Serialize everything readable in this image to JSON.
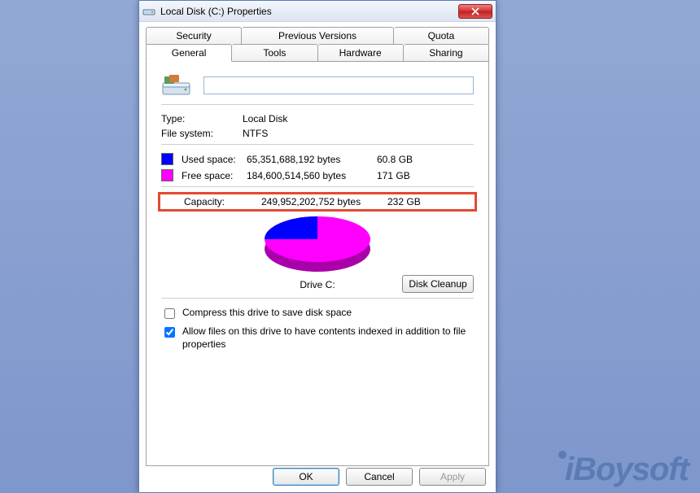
{
  "window": {
    "title": "Local Disk (C:) Properties"
  },
  "tabs_back": [
    {
      "label": "Security"
    },
    {
      "label": "Previous Versions"
    },
    {
      "label": "Quota"
    }
  ],
  "tabs_front": [
    {
      "label": "General"
    },
    {
      "label": "Tools"
    },
    {
      "label": "Hardware"
    },
    {
      "label": "Sharing"
    }
  ],
  "drive_name": "",
  "info": {
    "type_label": "Type:",
    "type_value": "Local Disk",
    "fs_label": "File system:",
    "fs_value": "NTFS"
  },
  "used": {
    "label": "Used space:",
    "bytes": "65,351,688,192 bytes",
    "human": "60.8 GB"
  },
  "free": {
    "label": "Free space:",
    "bytes": "184,600,514,560 bytes",
    "human": "171 GB"
  },
  "capacity": {
    "label": "Capacity:",
    "bytes": "249,952,202,752 bytes",
    "human": "232 GB"
  },
  "drive_label": "Drive C:",
  "buttons": {
    "disk_cleanup": "Disk Cleanup",
    "ok": "OK",
    "cancel": "Cancel",
    "apply": "Apply"
  },
  "checkboxes": {
    "compress": "Compress this drive to save disk space",
    "index": "Allow files on this drive to have contents indexed in addition to file properties"
  },
  "watermark": "iBoysoft",
  "chart_data": {
    "type": "pie",
    "title": "Drive C:",
    "series": [
      {
        "name": "Used space",
        "value": 65351688192,
        "human": "60.8 GB",
        "color": "#0000ff"
      },
      {
        "name": "Free space",
        "value": 184600514560,
        "human": "171 GB",
        "color": "#ff00ff"
      }
    ],
    "total": {
      "name": "Capacity",
      "value": 249952202752,
      "human": "232 GB"
    }
  }
}
